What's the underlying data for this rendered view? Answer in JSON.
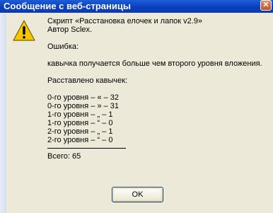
{
  "window": {
    "title": "Сообщение с веб-страницы",
    "close_glyph": "✕"
  },
  "message": {
    "line1": "Скрипт «Расстановка елочек и лапок v2.9»",
    "line2": "Автор Sclex.",
    "error_label": "Ошибка:",
    "error_text": "кавычка получается больше чем второго уровня вложения.",
    "summary_label": "Расставлено кавычек:",
    "counts": [
      "0-го уровня – « – 32",
      "0-го уровня – » – 31",
      "1-го уровня – „ – 1",
      "1-го уровня – “ – 0",
      "2-го уровня – „ – 1",
      "2-го уровня – “ – 0"
    ],
    "total": "Всего: 65"
  },
  "buttons": {
    "ok_label": "OK"
  },
  "icons": {
    "warning": "warning-icon",
    "close": "close-icon"
  },
  "colors": {
    "titlebar": "#0a3fbd",
    "dialog_bg": "#ece9d8",
    "warning_fill": "#f5c700"
  }
}
